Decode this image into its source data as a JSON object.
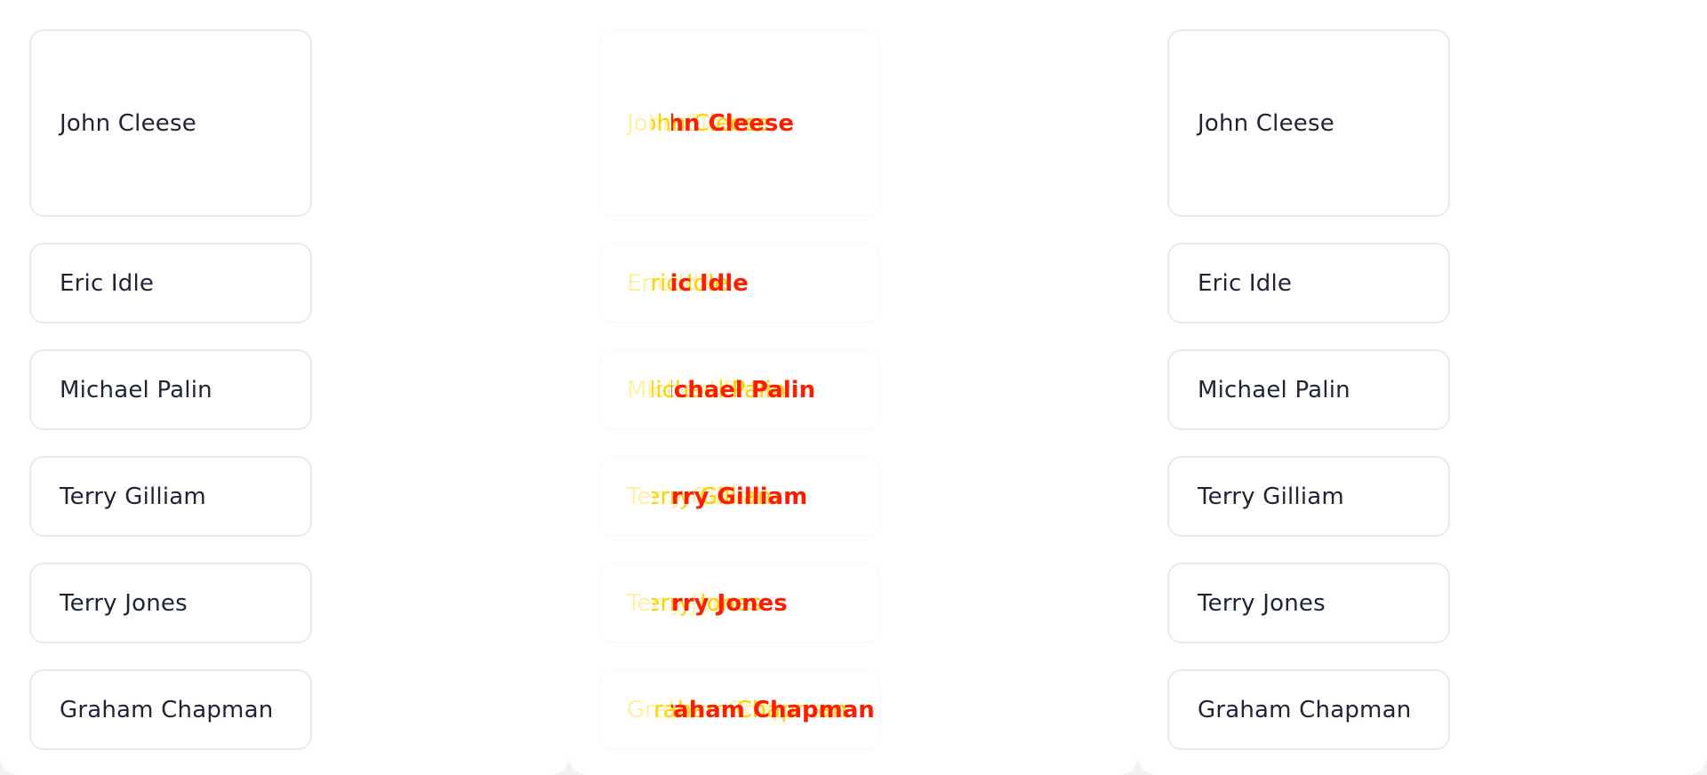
{
  "left_list": {
    "items": [
      {
        "label": "John Cleese"
      },
      {
        "label": "Eric Idle"
      },
      {
        "label": "Michael Palin"
      },
      {
        "label": "Terry Gilliam"
      },
      {
        "label": "Terry Jones"
      },
      {
        "label": "Graham Chapman"
      }
    ]
  },
  "middle_list": {
    "items": [
      {
        "label": "John Cleese"
      },
      {
        "label": "Eric Idle"
      },
      {
        "label": "Michael Palin"
      },
      {
        "label": "Terry Gilliam"
      },
      {
        "label": "Terry Jones"
      },
      {
        "label": "Graham Chapman"
      }
    ],
    "colors": {
      "pale": "#fff0a8",
      "yellow": "#ffd200",
      "red": "#ff1c00"
    }
  },
  "right_list": {
    "items": [
      {
        "label": "John Cleese"
      },
      {
        "label": "Eric Idle"
      },
      {
        "label": "Michael Palin"
      },
      {
        "label": "Terry Gilliam"
      },
      {
        "label": "Terry Jones"
      },
      {
        "label": "Graham Chapman"
      }
    ]
  }
}
